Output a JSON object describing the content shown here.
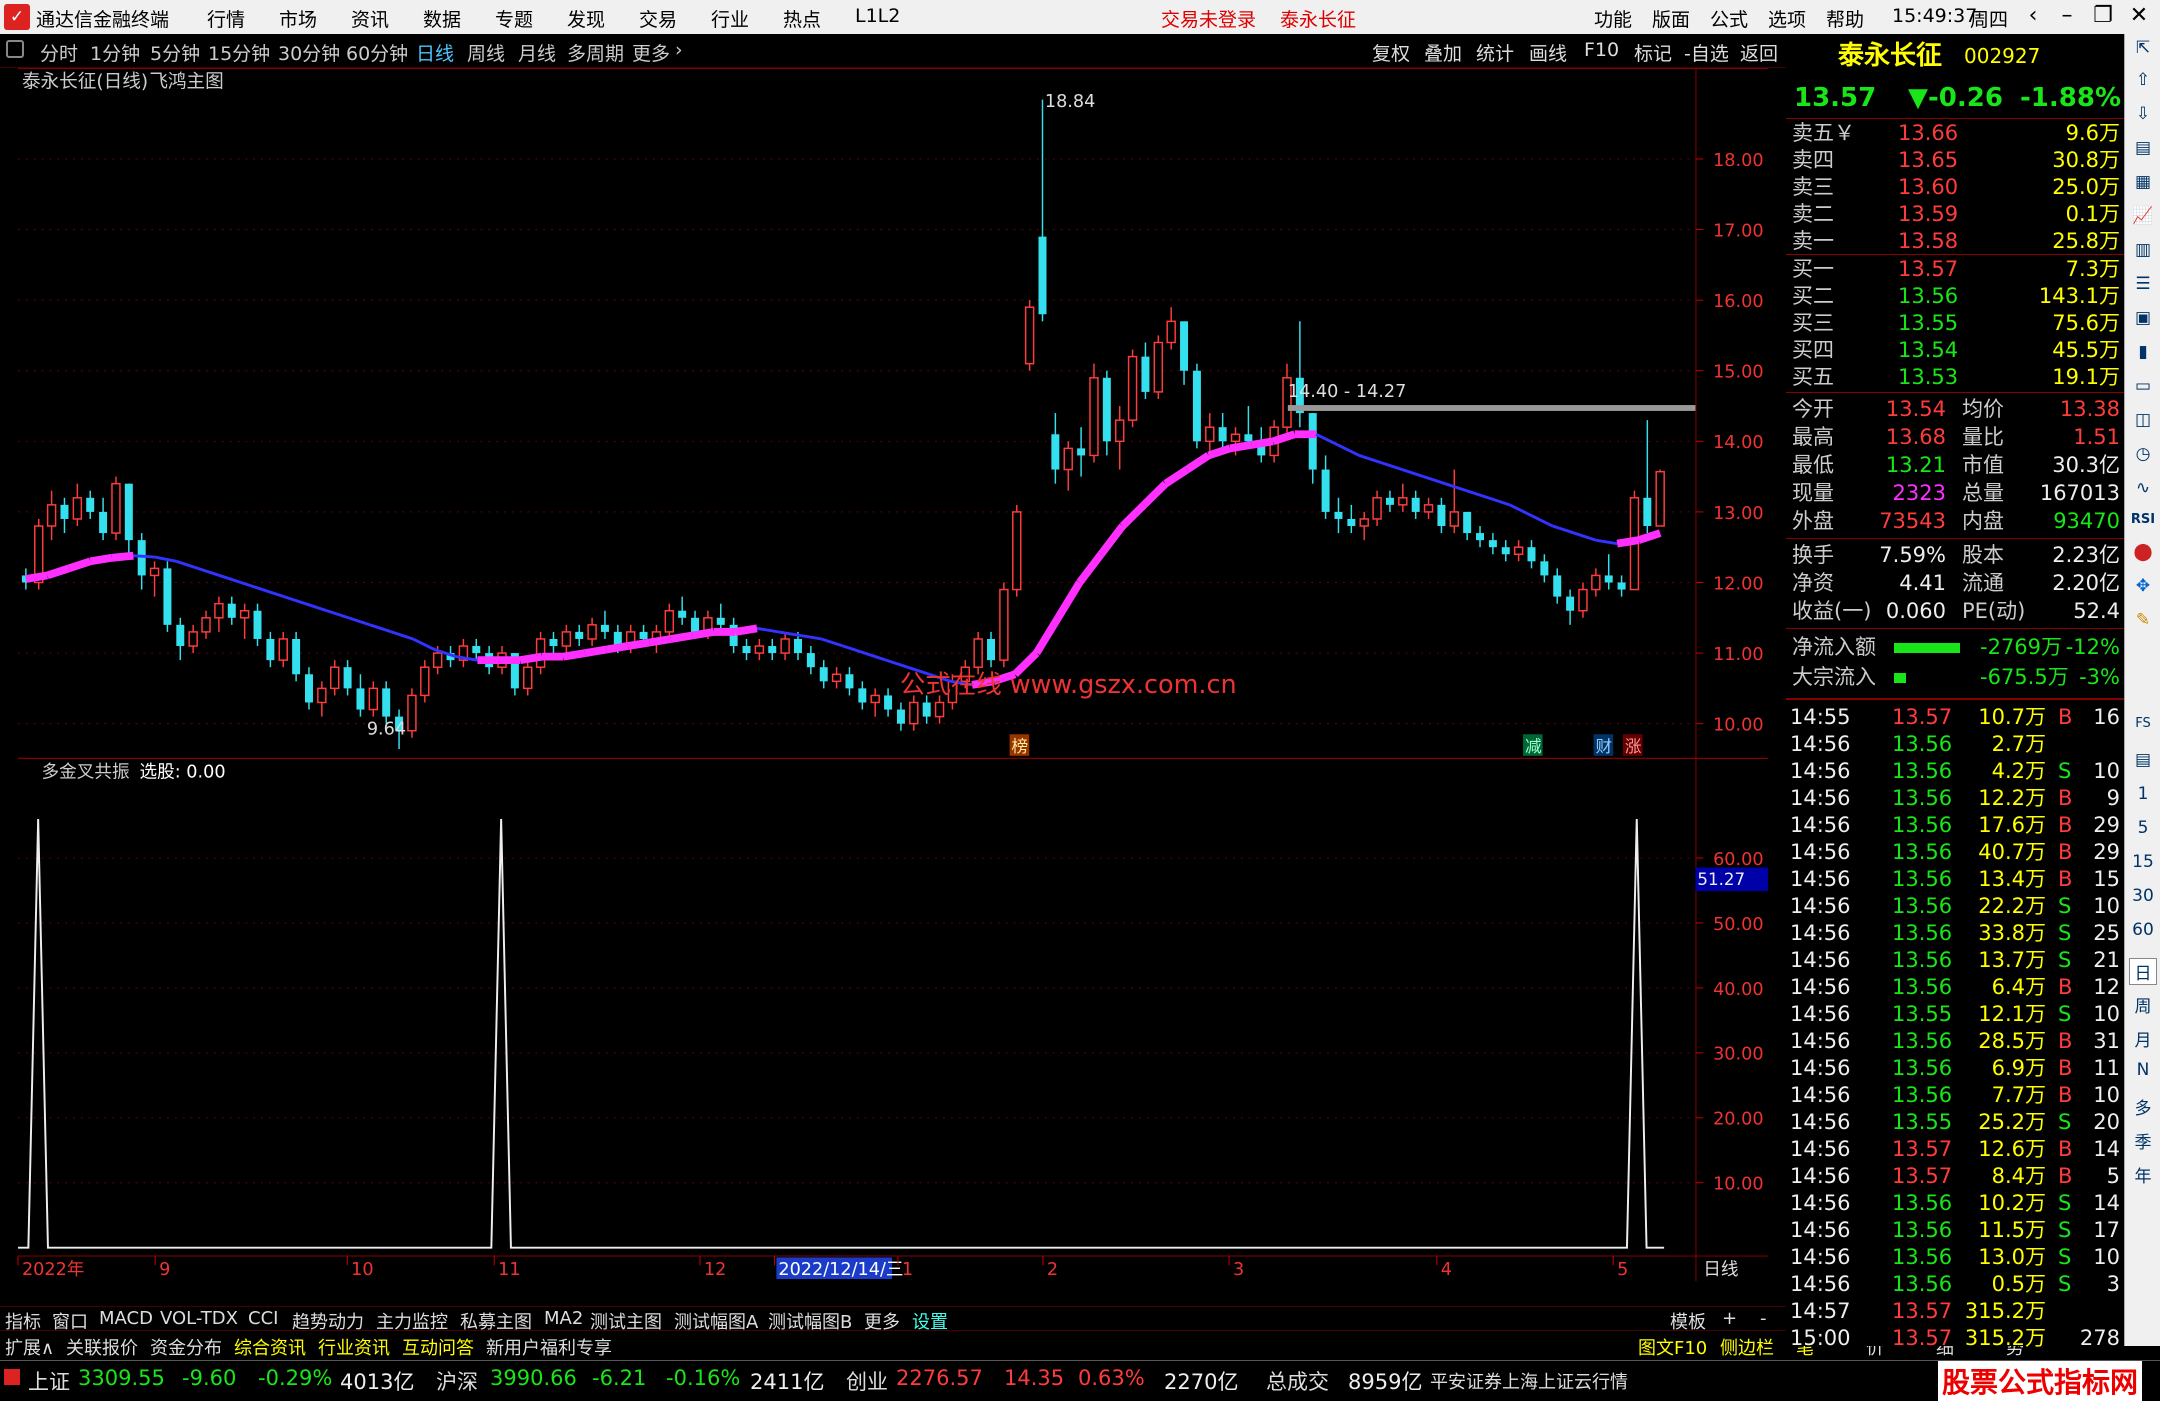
{
  "titlebar": {
    "app_title": "通达信金融终端",
    "menus": [
      "行情",
      "市场",
      "资讯",
      "数据",
      "专题",
      "发现",
      "交易",
      "行业",
      "热点",
      "L1L2"
    ],
    "status_login": "交易未登录",
    "stock_name": "泰永长征",
    "right_menus": [
      "功能",
      "版面",
      "公式",
      "选项",
      "帮助"
    ],
    "time": "15:49:37",
    "weekday": "周四"
  },
  "periodbar": {
    "periods": [
      "分时",
      "1分钟",
      "5分钟",
      "15分钟",
      "30分钟",
      "60分钟",
      "日线",
      "周线",
      "月线",
      "多周期",
      "更多"
    ],
    "active": "日线",
    "right_buttons": [
      "复权",
      "叠加",
      "统计",
      "画线",
      "F10",
      "标记",
      "-自选",
      "返回"
    ]
  },
  "main_chart": {
    "title": "泰永长征(日线)",
    "formula": "飞鸿主图",
    "high_label": "18.84",
    "low_label": "9.64",
    "range_label": "14.40 - 14.27",
    "watermark": "公式在线  www.gszx.com.cn",
    "y_ticks": [
      "18.00",
      "17.00",
      "16.00",
      "15.00",
      "14.00",
      "13.00",
      "12.00",
      "11.00",
      "10.00"
    ],
    "event_marks": [
      "榜",
      "减",
      "财",
      "涨"
    ]
  },
  "chart_data": [
    {
      "type": "candlestick",
      "title": "泰永长征(日线)",
      "ylim": [
        9.6,
        18.9
      ],
      "x_ticks": [
        "2022年",
        "9",
        "10",
        "11",
        "12",
        "2022/12/14/三",
        "1",
        "2",
        "3",
        "4",
        "5"
      ],
      "ohlc": [
        [
          12.1,
          12.2,
          11.9,
          12.0
        ],
        [
          12.0,
          12.9,
          11.9,
          12.8
        ],
        [
          12.8,
          13.3,
          12.6,
          13.1
        ],
        [
          13.1,
          13.2,
          12.7,
          12.9
        ],
        [
          12.9,
          13.4,
          12.8,
          13.2
        ],
        [
          13.2,
          13.3,
          12.9,
          13.0
        ],
        [
          13.0,
          13.2,
          12.6,
          12.7
        ],
        [
          12.7,
          13.5,
          12.6,
          13.4
        ],
        [
          13.4,
          13.4,
          12.4,
          12.6
        ],
        [
          12.6,
          12.7,
          11.9,
          12.1
        ],
        [
          12.1,
          12.3,
          11.8,
          12.2
        ],
        [
          12.2,
          12.3,
          11.3,
          11.4
        ],
        [
          11.4,
          11.5,
          10.9,
          11.1
        ],
        [
          11.1,
          11.4,
          11.0,
          11.3
        ],
        [
          11.3,
          11.6,
          11.2,
          11.5
        ],
        [
          11.5,
          11.8,
          11.3,
          11.7
        ],
        [
          11.7,
          11.8,
          11.4,
          11.5
        ],
        [
          11.5,
          11.7,
          11.2,
          11.6
        ],
        [
          11.6,
          11.7,
          11.1,
          11.2
        ],
        [
          11.2,
          11.3,
          10.8,
          10.9
        ],
        [
          10.9,
          11.3,
          10.8,
          11.2
        ],
        [
          11.2,
          11.3,
          10.6,
          10.7
        ],
        [
          10.7,
          10.8,
          10.2,
          10.3
        ],
        [
          10.3,
          10.6,
          10.1,
          10.5
        ],
        [
          10.5,
          10.9,
          10.4,
          10.8
        ],
        [
          10.8,
          10.9,
          10.4,
          10.5
        ],
        [
          10.5,
          10.7,
          10.1,
          10.2
        ],
        [
          10.2,
          10.6,
          10.1,
          10.5
        ],
        [
          10.5,
          10.6,
          10.0,
          10.1
        ],
        [
          10.1,
          10.2,
          9.64,
          9.9
        ],
        [
          9.9,
          10.5,
          9.8,
          10.4
        ],
        [
          10.4,
          10.9,
          10.3,
          10.8
        ],
        [
          10.8,
          11.1,
          10.7,
          11.0
        ],
        [
          11.0,
          11.1,
          10.8,
          10.9
        ],
        [
          10.9,
          11.2,
          10.8,
          11.1
        ],
        [
          11.1,
          11.2,
          10.9,
          11.0
        ],
        [
          11.0,
          11.1,
          10.7,
          10.8
        ],
        [
          10.8,
          11.1,
          10.7,
          11.0
        ],
        [
          11.0,
          11.0,
          10.4,
          10.5
        ],
        [
          10.5,
          10.9,
          10.4,
          10.8
        ],
        [
          10.8,
          11.3,
          10.7,
          11.2
        ],
        [
          11.2,
          11.3,
          11.0,
          11.1
        ],
        [
          11.1,
          11.4,
          11.0,
          11.3
        ],
        [
          11.3,
          11.4,
          11.1,
          11.2
        ],
        [
          11.2,
          11.5,
          11.1,
          11.4
        ],
        [
          11.4,
          11.6,
          11.2,
          11.3
        ],
        [
          11.3,
          11.4,
          11.0,
          11.1
        ],
        [
          11.1,
          11.4,
          11.0,
          11.3
        ],
        [
          11.3,
          11.4,
          11.1,
          11.2
        ],
        [
          11.2,
          11.4,
          11.0,
          11.3
        ],
        [
          11.3,
          11.7,
          11.2,
          11.6
        ],
        [
          11.6,
          11.8,
          11.4,
          11.5
        ],
        [
          11.5,
          11.6,
          11.2,
          11.3
        ],
        [
          11.3,
          11.6,
          11.2,
          11.5
        ],
        [
          11.5,
          11.7,
          11.3,
          11.4
        ],
        [
          11.4,
          11.5,
          11.0,
          11.1
        ],
        [
          11.1,
          11.2,
          10.9,
          11.0
        ],
        [
          11.0,
          11.2,
          10.9,
          11.1
        ],
        [
          11.1,
          11.2,
          10.9,
          11.0
        ],
        [
          11.0,
          11.3,
          10.9,
          11.2
        ],
        [
          11.2,
          11.3,
          10.9,
          11.0
        ],
        [
          11.0,
          11.1,
          10.7,
          10.8
        ],
        [
          10.8,
          10.9,
          10.5,
          10.6
        ],
        [
          10.6,
          10.8,
          10.5,
          10.7
        ],
        [
          10.7,
          10.8,
          10.4,
          10.5
        ],
        [
          10.5,
          10.6,
          10.2,
          10.3
        ],
        [
          10.3,
          10.5,
          10.1,
          10.4
        ],
        [
          10.4,
          10.5,
          10.1,
          10.2
        ],
        [
          10.2,
          10.3,
          9.9,
          10.0
        ],
        [
          10.0,
          10.4,
          9.9,
          10.3
        ],
        [
          10.3,
          10.4,
          10.0,
          10.1
        ],
        [
          10.1,
          10.4,
          10.0,
          10.3
        ],
        [
          10.3,
          10.7,
          10.2,
          10.6
        ],
        [
          10.6,
          10.9,
          10.5,
          10.8
        ],
        [
          10.8,
          11.3,
          10.7,
          11.2
        ],
        [
          11.2,
          11.3,
          10.8,
          10.9
        ],
        [
          10.9,
          12.0,
          10.8,
          11.9
        ],
        [
          11.9,
          13.1,
          11.8,
          13.0
        ],
        [
          15.1,
          16.0,
          15.0,
          15.9
        ],
        [
          16.9,
          18.84,
          15.7,
          15.8
        ],
        [
          14.1,
          14.4,
          13.4,
          13.6
        ],
        [
          13.6,
          14.0,
          13.3,
          13.9
        ],
        [
          13.9,
          14.2,
          13.5,
          13.8
        ],
        [
          13.8,
          15.1,
          13.7,
          14.9
        ],
        [
          14.9,
          15.0,
          13.8,
          14.0
        ],
        [
          14.0,
          14.5,
          13.6,
          14.3
        ],
        [
          14.3,
          15.3,
          14.2,
          15.2
        ],
        [
          15.2,
          15.4,
          14.6,
          14.7
        ],
        [
          14.7,
          15.5,
          14.6,
          15.4
        ],
        [
          15.4,
          15.9,
          15.3,
          15.7
        ],
        [
          15.7,
          15.7,
          14.8,
          15.0
        ],
        [
          15.0,
          15.1,
          13.9,
          14.0
        ],
        [
          14.0,
          14.4,
          13.8,
          14.2
        ],
        [
          14.2,
          14.4,
          13.9,
          14.0
        ],
        [
          14.0,
          14.2,
          13.8,
          14.1
        ],
        [
          14.1,
          14.5,
          13.9,
          14.0
        ],
        [
          14.0,
          14.2,
          13.7,
          13.8
        ],
        [
          13.8,
          14.3,
          13.7,
          14.2
        ],
        [
          14.2,
          15.1,
          14.1,
          14.9
        ],
        [
          14.9,
          15.7,
          14.2,
          14.4
        ],
        [
          14.4,
          14.4,
          13.4,
          13.6
        ],
        [
          13.6,
          13.8,
          12.9,
          13.0
        ],
        [
          13.0,
          13.2,
          12.7,
          12.9
        ],
        [
          12.9,
          13.1,
          12.7,
          12.8
        ],
        [
          12.8,
          13.0,
          12.6,
          12.9
        ],
        [
          12.9,
          13.3,
          12.8,
          13.2
        ],
        [
          13.2,
          13.3,
          13.0,
          13.1
        ],
        [
          13.1,
          13.4,
          13.0,
          13.2
        ],
        [
          13.2,
          13.3,
          12.9,
          13.0
        ],
        [
          13.0,
          13.2,
          12.9,
          13.1
        ],
        [
          13.1,
          13.2,
          12.7,
          12.8
        ],
        [
          12.8,
          13.6,
          12.7,
          13.0
        ],
        [
          13.0,
          13.0,
          12.6,
          12.7
        ],
        [
          12.7,
          12.8,
          12.5,
          12.6
        ],
        [
          12.6,
          12.7,
          12.4,
          12.5
        ],
        [
          12.5,
          12.6,
          12.3,
          12.4
        ],
        [
          12.4,
          12.6,
          12.3,
          12.5
        ],
        [
          12.5,
          12.6,
          12.2,
          12.3
        ],
        [
          12.3,
          12.4,
          12.0,
          12.1
        ],
        [
          12.1,
          12.2,
          11.7,
          11.8
        ],
        [
          11.8,
          11.9,
          11.4,
          11.6
        ],
        [
          11.6,
          12.0,
          11.5,
          11.9
        ],
        [
          11.9,
          12.2,
          11.8,
          12.1
        ],
        [
          12.1,
          12.4,
          11.9,
          12.0
        ],
        [
          12.0,
          12.1,
          11.8,
          11.9
        ],
        [
          11.9,
          13.3,
          11.9,
          13.2
        ],
        [
          13.2,
          14.3,
          12.7,
          12.8
        ],
        [
          12.8,
          13.6,
          12.8,
          13.57
        ]
      ],
      "ma_line": [
        12.05,
        12.1,
        12.2,
        12.3,
        12.35,
        12.38,
        12.36,
        12.3,
        12.2,
        12.1,
        12.0,
        11.9,
        11.8,
        11.7,
        11.6,
        11.5,
        11.4,
        11.3,
        11.2,
        11.05,
        10.95,
        10.9,
        10.9,
        10.9,
        10.95,
        10.95,
        11.0,
        11.05,
        11.1,
        11.15,
        11.2,
        11.25,
        11.3,
        11.3,
        11.35,
        11.3,
        11.25,
        11.2,
        11.1,
        11.0,
        10.9,
        10.8,
        10.7,
        10.6,
        10.55,
        10.6,
        10.7,
        11.0,
        11.5,
        12.0,
        12.4,
        12.8,
        13.1,
        13.4,
        13.6,
        13.8,
        13.9,
        13.95,
        14.0,
        14.1,
        14.1,
        13.95,
        13.8,
        13.7,
        13.6,
        13.5,
        13.4,
        13.3,
        13.2,
        13.1,
        12.95,
        12.8,
        12.7,
        12.6,
        12.55,
        12.6,
        12.7
      ]
    },
    {
      "type": "line",
      "title": "多金叉共振",
      "subtitle": "选股: 0.00",
      "current_value": "51.27",
      "ylim": [
        0,
        70
      ],
      "y_ticks": [
        "60.00",
        "50.00",
        "40.00",
        "30.00",
        "20.00",
        "10.00"
      ],
      "spikes_x_fraction": [
        0.012,
        0.288,
        0.965
      ],
      "spike_value": 66
    }
  ],
  "indicator_tabs": [
    "指标",
    "窗口",
    "MACD",
    "VOL-TDX",
    "CCI",
    "趋势动力",
    "主力监控",
    "私募主图",
    "MA2",
    "测试主图",
    "测试幅图A",
    "测试幅图B",
    "更多",
    "设置"
  ],
  "indicator_right": [
    "模板",
    "+",
    "-"
  ],
  "day_label": "日线",
  "bottom_tabs": [
    "扩展∧",
    "关联报价",
    "资金分布",
    "综合资讯",
    "行业资讯",
    "互动问答",
    "新用户福利专享"
  ],
  "bottom_right": [
    "图文F10",
    "侧边栏《",
    "笔",
    "价",
    "细",
    "势"
  ],
  "quote": {
    "name": "泰永长征",
    "code": "002927",
    "price": "13.57",
    "change": "▼-0.26",
    "pct": "-1.88%",
    "asks": [
      {
        "label": "卖五￥",
        "price": "13.66",
        "vol": "9.6万"
      },
      {
        "label": "卖四",
        "price": "13.65",
        "vol": "30.8万"
      },
      {
        "label": "卖三",
        "price": "13.60",
        "vol": "25.0万"
      },
      {
        "label": "卖二",
        "price": "13.59",
        "vol": "0.1万"
      },
      {
        "label": "卖一",
        "price": "13.58",
        "vol": "25.8万"
      }
    ],
    "bids": [
      {
        "label": "买一",
        "price": "13.57",
        "vol": "7.3万"
      },
      {
        "label": "买二",
        "price": "13.56",
        "vol": "143.1万"
      },
      {
        "label": "买三",
        "price": "13.55",
        "vol": "75.6万"
      },
      {
        "label": "买四",
        "price": "13.54",
        "vol": "45.5万"
      },
      {
        "label": "买五",
        "price": "13.53",
        "vol": "19.1万"
      }
    ],
    "stats1": [
      {
        "l1": "今开",
        "v1": "13.54",
        "l2": "均价",
        "v2": "13.38"
      },
      {
        "l1": "最高",
        "v1": "13.68",
        "l2": "量比",
        "v2": "1.51"
      },
      {
        "l1": "最低",
        "v1": "13.21",
        "l2": "市值",
        "v2": "30.3亿"
      },
      {
        "l1": "现量",
        "v1": "2323",
        "l2": "总量",
        "v2": "167013"
      },
      {
        "l1": "外盘",
        "v1": "73543",
        "l2": "内盘",
        "v2": "93470"
      }
    ],
    "stats2": [
      {
        "l1": "换手",
        "v1": "7.59%",
        "l2": "股本",
        "v2": "2.23亿"
      },
      {
        "l1": "净资",
        "v1": "4.41",
        "l2": "流通",
        "v2": "2.20亿"
      },
      {
        "l1": "收益(一)",
        "v1": "0.060",
        "l2": "PE(动)",
        "v2": "52.4"
      }
    ],
    "flows": [
      {
        "label": "净流入额",
        "val": "-2769万",
        "pct": "-12%",
        "bar": 0.85
      },
      {
        "label": "大宗流入",
        "val": "-675.5万",
        "pct": "-3%",
        "bar": 0.15
      }
    ],
    "ticks": [
      [
        "14:55",
        "13.57",
        "10.7万",
        "B",
        "16"
      ],
      [
        "14:56",
        "13.56",
        "2.7万",
        "",
        ""
      ],
      [
        "14:56",
        "13.56",
        "4.2万",
        "S",
        "10"
      ],
      [
        "14:56",
        "13.56",
        "12.2万",
        "B",
        "9"
      ],
      [
        "14:56",
        "13.56",
        "17.6万",
        "B",
        "29"
      ],
      [
        "14:56",
        "13.56",
        "40.7万",
        "B",
        "29"
      ],
      [
        "14:56",
        "13.56",
        "13.4万",
        "B",
        "15"
      ],
      [
        "14:56",
        "13.56",
        "22.2万",
        "S",
        "10"
      ],
      [
        "14:56",
        "13.56",
        "33.8万",
        "S",
        "25"
      ],
      [
        "14:56",
        "13.56",
        "13.7万",
        "S",
        "21"
      ],
      [
        "14:56",
        "13.56",
        "6.4万",
        "B",
        "12"
      ],
      [
        "14:56",
        "13.55",
        "12.1万",
        "S",
        "10"
      ],
      [
        "14:56",
        "13.56",
        "28.5万",
        "B",
        "31"
      ],
      [
        "14:56",
        "13.56",
        "6.9万",
        "B",
        "11"
      ],
      [
        "14:56",
        "13.56",
        "7.7万",
        "B",
        "10"
      ],
      [
        "14:56",
        "13.55",
        "25.2万",
        "S",
        "20"
      ],
      [
        "14:56",
        "13.57",
        "12.6万",
        "B",
        "14"
      ],
      [
        "14:56",
        "13.57",
        "8.4万",
        "B",
        "5"
      ],
      [
        "14:56",
        "13.56",
        "10.2万",
        "S",
        "14"
      ],
      [
        "14:56",
        "13.56",
        "11.5万",
        "S",
        "17"
      ],
      [
        "14:56",
        "13.56",
        "13.0万",
        "S",
        "10"
      ],
      [
        "14:56",
        "13.56",
        "0.5万",
        "S",
        "3"
      ],
      [
        "14:57",
        "13.57",
        "315.2万",
        "",
        ""
      ],
      [
        "15:00",
        "13.57",
        "315.2万",
        "",
        "278"
      ]
    ]
  },
  "sidebar_labels": [
    "RSI",
    "FS",
    "1",
    "5",
    "15",
    "30",
    "60",
    "日",
    "周",
    "月",
    "N",
    "多",
    "季",
    "年"
  ],
  "statusbar": {
    "items": [
      {
        "name": "上证",
        "v": "3309.55",
        "c": "-9.60",
        "p": "-0.29%",
        "a": "4013亿"
      },
      {
        "name": "沪深",
        "v": "3990.66",
        "c": "-6.21",
        "p": "-0.16%",
        "a": "2411亿"
      },
      {
        "name": "创业",
        "v": "2276.57",
        "c": "14.35",
        "p": "0.63%",
        "a": "2270亿"
      }
    ],
    "total_label": "总成交",
    "total": "8959亿",
    "server": "平安证券上海上证云行情",
    "logo_text": "股票公式指标网",
    "logo_url": "www.gszx.com.cn"
  },
  "colors": {
    "up": "#ff3c3c",
    "down": "#35e0ee",
    "ma_up": "#ff2fff",
    "ma_down": "#3333ff"
  }
}
